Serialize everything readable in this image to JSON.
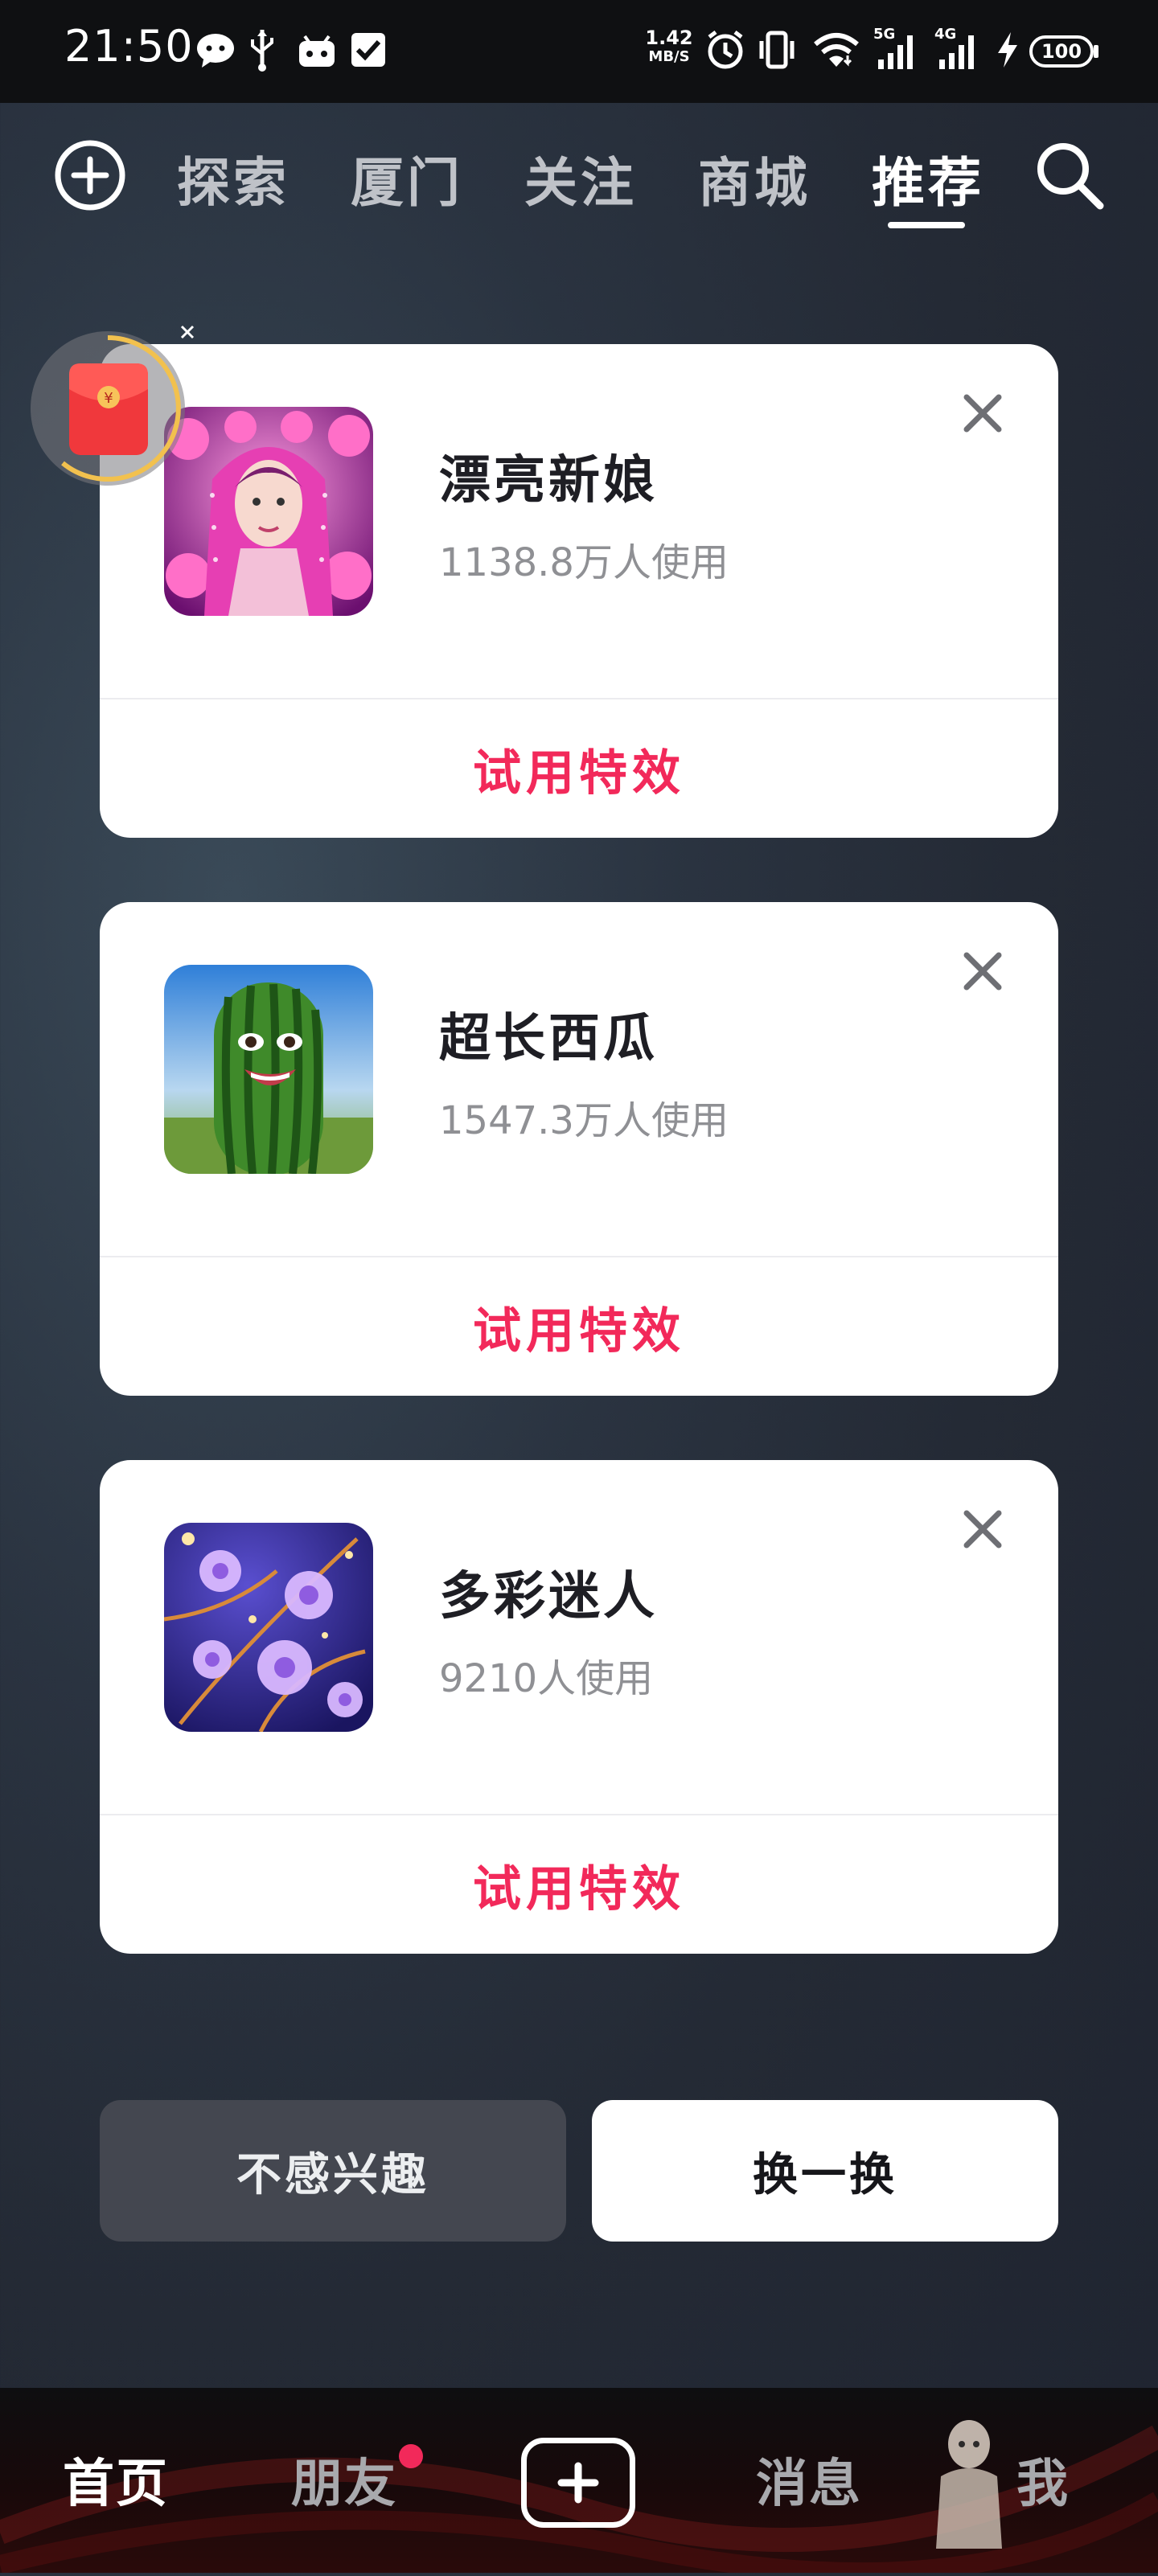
{
  "status_bar": {
    "time": "21:50",
    "speed_value": "1.42",
    "speed_unit": "MB/S",
    "net_5g": "5G",
    "net_4g": "4G",
    "battery": "100",
    "icons": [
      "wechat-icon",
      "usb-icon",
      "android-icon",
      "checkbox-icon",
      "alarm-icon",
      "vibrate-icon",
      "wifi-icon",
      "signal-icon",
      "signal-icon",
      "charging-icon",
      "battery-icon"
    ]
  },
  "top_nav": {
    "tabs": [
      {
        "label": "探索"
      },
      {
        "label": "厦门"
      },
      {
        "label": "关注"
      },
      {
        "label": "商城"
      },
      {
        "label": "推荐"
      }
    ],
    "active_tab": "推荐"
  },
  "cards": [
    {
      "title": "漂亮新娘",
      "usage": "1138.8万人使用",
      "button": "试用特效"
    },
    {
      "title": "超长西瓜",
      "usage": "1547.3万人使用",
      "button": "试用特效"
    },
    {
      "title": "多彩迷人",
      "usage": "9210人使用",
      "button": "试用特效"
    }
  ],
  "actions": {
    "not_interested": "不感兴趣",
    "refresh": "换一换"
  },
  "bottom_nav": {
    "home": "首页",
    "friends": "朋友",
    "messages": "消息",
    "me": "我"
  },
  "colors": {
    "accent": "#f2295a",
    "card_bg": "#ffffff",
    "status_bar_bg": "#0f1012"
  }
}
